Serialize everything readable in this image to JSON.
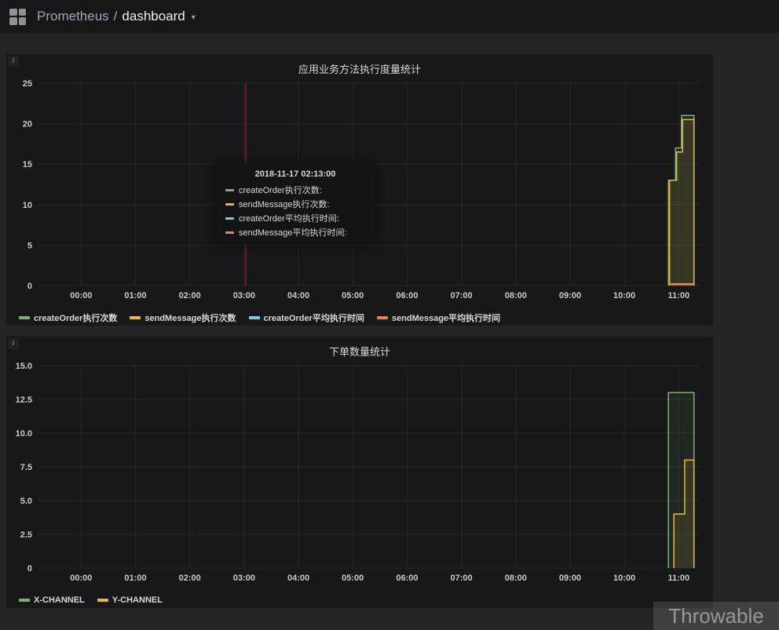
{
  "navbar": {
    "app": "Prometheus",
    "separator": "/",
    "page": "dashboard"
  },
  "icons": {
    "caret": "▾",
    "panel_info": "i"
  },
  "watermark": "Throwable",
  "tooltip": {
    "title": "2018-11-17 02:13:00",
    "rows": [
      {
        "color": "#7eb26d",
        "label": "createOrder执行次数:"
      },
      {
        "color": "#eab839",
        "label": "sendMessage执行次数:"
      },
      {
        "color": "#6ed0e0",
        "label": "createOrder平均执行时间:"
      },
      {
        "color": "#ef843c",
        "label": "sendMessage平均执行时间:"
      }
    ]
  },
  "chart_data": [
    {
      "type": "line",
      "title": "应用业务方法执行度量统计",
      "xlabel": "",
      "ylabel": "",
      "x_domain": [
        -0.8,
        11.4
      ],
      "x_tick_hours": [
        0,
        1,
        2,
        3,
        4,
        5,
        6,
        7,
        8,
        9,
        10,
        11
      ],
      "x_tick_labels": [
        "00:00",
        "01:00",
        "02:00",
        "03:00",
        "04:00",
        "05:00",
        "06:00",
        "07:00",
        "08:00",
        "09:00",
        "10:00",
        "11:00"
      ],
      "ylim": [
        0,
        25
      ],
      "y_ticks": [
        0,
        5,
        10,
        15,
        20,
        25
      ],
      "y_tick_labels": [
        "0",
        "5",
        "10",
        "15",
        "20",
        "25"
      ],
      "grid": true,
      "legend_position": "bottom",
      "crosshair_hour": 3.03,
      "crosshair_color": "#c42020",
      "series": [
        {
          "name": "createOrder执行次数",
          "color": "#7eb26d",
          "fill_opacity": 0.1,
          "points": [
            [
              10.81,
              0
            ],
            [
              10.81,
              13
            ],
            [
              10.94,
              13
            ],
            [
              10.94,
              17
            ],
            [
              11.05,
              17
            ],
            [
              11.05,
              21
            ],
            [
              11.28,
              21
            ],
            [
              11.28,
              0
            ]
          ]
        },
        {
          "name": "sendMessage执行次数",
          "color": "#eab839",
          "fill_opacity": 0.1,
          "points": [
            [
              10.83,
              0
            ],
            [
              10.83,
              13
            ],
            [
              10.96,
              13
            ],
            [
              10.96,
              16.5
            ],
            [
              11.07,
              16.5
            ],
            [
              11.07,
              20.5
            ],
            [
              11.28,
              20.5
            ],
            [
              11.28,
              0
            ]
          ]
        },
        {
          "name": "createOrder平均执行时间",
          "color": "#6ed0e0",
          "fill_opacity": 0.1,
          "points": [
            [
              10.81,
              0.2
            ],
            [
              11.28,
              0.2
            ]
          ]
        },
        {
          "name": "sendMessage平均执行时间",
          "color": "#ef843c",
          "fill_opacity": 0.1,
          "points": [
            [
              10.81,
              0.12
            ],
            [
              11.28,
              0.12
            ]
          ]
        }
      ]
    },
    {
      "type": "line",
      "title": "下单数量统计",
      "xlabel": "",
      "ylabel": "",
      "x_domain": [
        -0.8,
        11.4
      ],
      "x_tick_hours": [
        0,
        1,
        2,
        3,
        4,
        5,
        6,
        7,
        8,
        9,
        10,
        11
      ],
      "x_tick_labels": [
        "00:00",
        "01:00",
        "02:00",
        "03:00",
        "04:00",
        "05:00",
        "06:00",
        "07:00",
        "08:00",
        "09:00",
        "10:00",
        "11:00"
      ],
      "ylim": [
        0,
        15
      ],
      "y_ticks": [
        0,
        2.5,
        5,
        7.5,
        10,
        12.5,
        15
      ],
      "y_tick_labels": [
        "0",
        "2.5",
        "5.0",
        "7.5",
        "10.0",
        "12.5",
        "15.0"
      ],
      "grid": true,
      "legend_position": "bottom",
      "crosshair_hour": null,
      "crosshair_color": null,
      "series": [
        {
          "name": "X-CHANNEL",
          "color": "#7eb26d",
          "fill_opacity": 0.1,
          "points": [
            [
              10.81,
              0
            ],
            [
              10.81,
              13
            ],
            [
              11.28,
              13
            ],
            [
              11.28,
              0
            ]
          ]
        },
        {
          "name": "Y-CHANNEL",
          "color": "#eab839",
          "fill_opacity": 0.1,
          "points": [
            [
              10.91,
              0
            ],
            [
              10.91,
              4
            ],
            [
              11.11,
              4
            ],
            [
              11.11,
              8
            ],
            [
              11.28,
              8
            ],
            [
              11.28,
              0
            ]
          ]
        }
      ]
    }
  ]
}
